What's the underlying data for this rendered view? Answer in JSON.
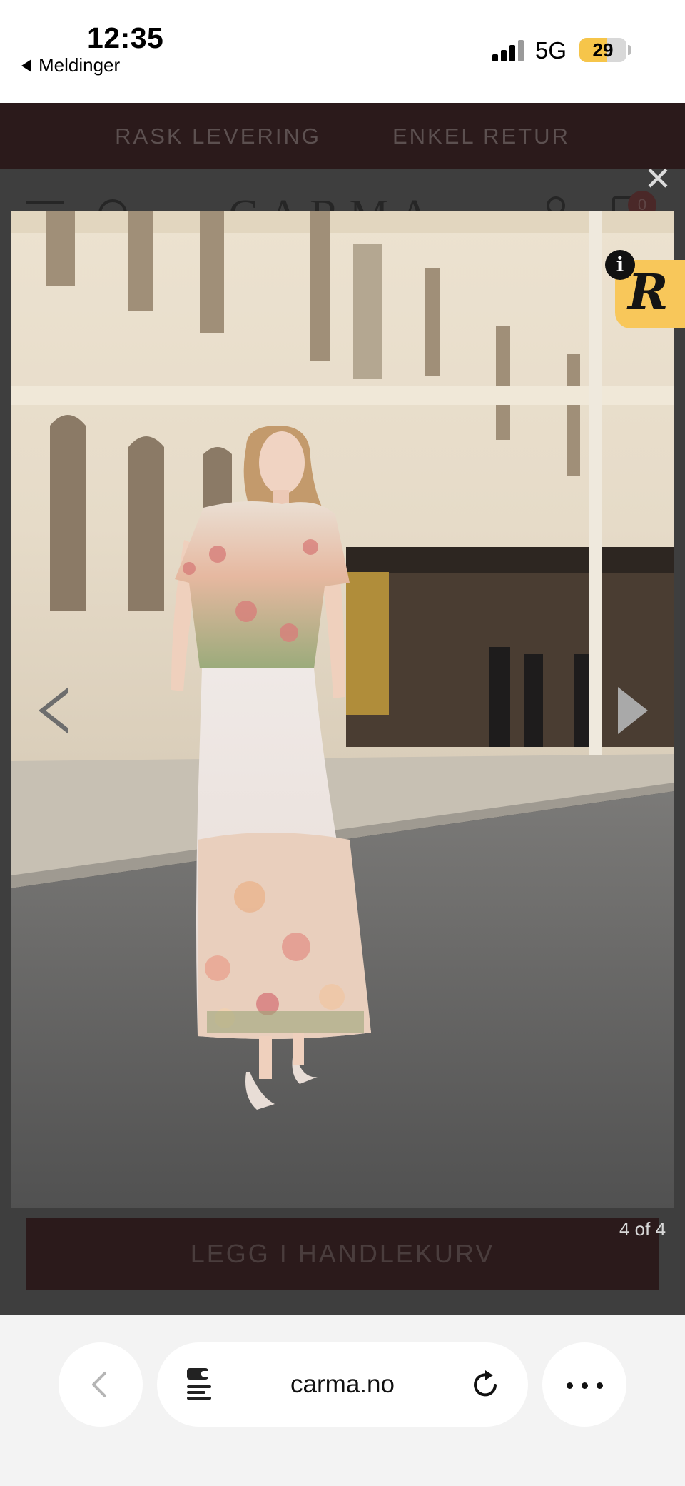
{
  "status_bar": {
    "time": "12:35",
    "back_app": "Meldinger",
    "network": "5G",
    "battery": "29"
  },
  "promo": {
    "items": [
      "RASK LEVERING",
      "ENKEL RETUR"
    ]
  },
  "site": {
    "logo": "CARMA",
    "cart_count": "0"
  },
  "lightbox": {
    "close_label": "✕",
    "counter": "4 of 4",
    "add_to_cart": "LEGG I HANDLEKURV"
  },
  "badge": {
    "letter": "R",
    "info": "i"
  },
  "browser": {
    "url": "carma.no"
  },
  "colors": {
    "banner": "#2b1a1b",
    "overlay": "#3e3e3e",
    "badge": "#f8c75a"
  }
}
